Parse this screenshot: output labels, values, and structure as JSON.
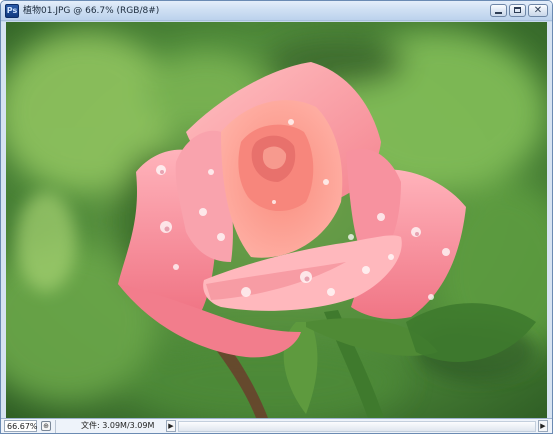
{
  "window": {
    "app_icon": "photoshop-document-icon",
    "title": "植物01.JPG @ 66.7% (RGB/8#)",
    "controls": {
      "minimize": "minimize-icon",
      "maximize": "maximize-icon",
      "close": "close-icon",
      "close_glyph": "✕"
    }
  },
  "canvas": {
    "subject": "pink rose with water droplets on green background",
    "colors": {
      "background_green": "#4f8a3a",
      "rose_pink": "#f28a98"
    }
  },
  "status": {
    "zoom": "66.67%",
    "doc_size": "文件: 3.09M/3.09M",
    "arrow_glyph": "▶",
    "icon_glyph": "⊕"
  }
}
